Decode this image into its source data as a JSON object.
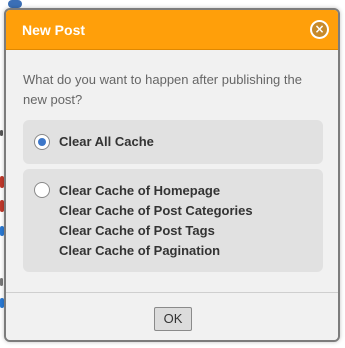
{
  "dialog": {
    "title": "New Post",
    "close_icon": "close-icon",
    "question": "What do you want to happen after publishing the new post?",
    "options": [
      {
        "label": "Clear All Cache",
        "checked": true
      },
      {
        "lines": [
          "Clear Cache of Homepage",
          "Clear Cache of Post Categories",
          "Clear Cache of Post Tags",
          "Clear Cache of Pagination"
        ],
        "checked": false
      }
    ],
    "ok_label": "OK"
  },
  "colors": {
    "titlebar": "#ff9f0a",
    "radio_selected": "#3d77c9",
    "option_bg": "#e1e1e1",
    "dialog_bg": "#f1f1f1"
  }
}
